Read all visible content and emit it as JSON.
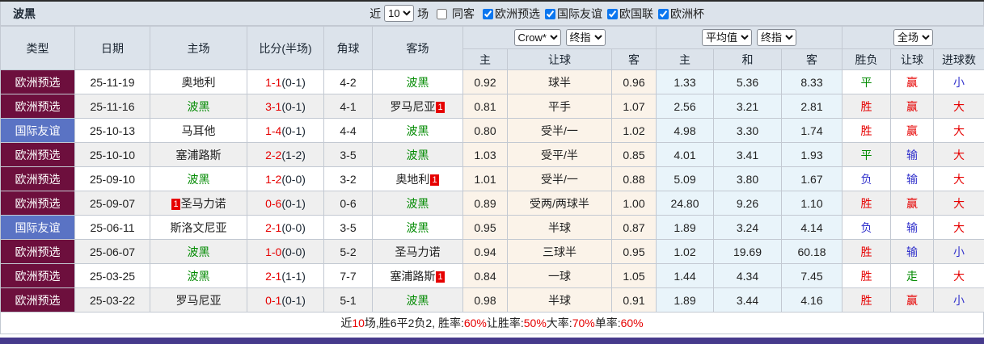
{
  "title": "波黑",
  "topbar": {
    "near_label": "近",
    "match_count": "10",
    "games_label": "场",
    "same_away": {
      "label": "同客",
      "checked": false
    },
    "filters": [
      {
        "label": "欧洲预选",
        "checked": true
      },
      {
        "label": "国际友谊",
        "checked": true
      },
      {
        "label": "欧国联",
        "checked": true
      },
      {
        "label": "欧洲杯",
        "checked": true
      }
    ]
  },
  "header": {
    "main": [
      "类型",
      "日期",
      "主场",
      "比分(半场)",
      "角球",
      "客场"
    ],
    "selects": {
      "bookmaker": "Crow*",
      "final1": "终指",
      "average": "平均值",
      "final2": "终指",
      "scope": "全场"
    },
    "sub": [
      "主",
      "让球",
      "客",
      "主",
      "和",
      "客",
      "胜负",
      "让球",
      "进球数"
    ]
  },
  "rows": [
    {
      "comp": "欧洲预选",
      "comp_style": "maroon",
      "date": "25-11-19",
      "home": {
        "name": "奥地利",
        "green": false,
        "badge": null
      },
      "score": {
        "full": "1-1",
        "half": "(0-1)"
      },
      "corner": "4-2",
      "away": {
        "name": "波黑",
        "green": true,
        "badge": null
      },
      "ah": {
        "home": "0.92",
        "line": "球半",
        "away": "0.96"
      },
      "eu": {
        "home": "1.33",
        "draw": "5.36",
        "away": "8.33"
      },
      "results": {
        "outcome": {
          "text": "平",
          "color": "green"
        },
        "handicap": {
          "text": "赢",
          "color": "red"
        },
        "goals": {
          "text": "小",
          "color": "blue"
        }
      }
    },
    {
      "comp": "欧洲预选",
      "comp_style": "maroon",
      "date": "25-11-16",
      "home": {
        "name": "波黑",
        "green": true,
        "badge": null
      },
      "score": {
        "full": "3-1",
        "half": "(0-1)"
      },
      "corner": "4-1",
      "away": {
        "name": "罗马尼亚",
        "green": false,
        "badge": {
          "text": "1",
          "pos": "after"
        }
      },
      "ah": {
        "home": "0.81",
        "line": "平手",
        "away": "1.07"
      },
      "eu": {
        "home": "2.56",
        "draw": "3.21",
        "away": "2.81"
      },
      "results": {
        "outcome": {
          "text": "胜",
          "color": "red"
        },
        "handicap": {
          "text": "赢",
          "color": "red"
        },
        "goals": {
          "text": "大",
          "color": "red"
        }
      }
    },
    {
      "comp": "国际友谊",
      "comp_style": "blue",
      "date": "25-10-13",
      "home": {
        "name": "马耳他",
        "green": false,
        "badge": null
      },
      "score": {
        "full": "1-4",
        "half": "(0-1)"
      },
      "corner": "4-4",
      "away": {
        "name": "波黑",
        "green": true,
        "badge": null
      },
      "ah": {
        "home": "0.80",
        "line": "受半/一",
        "away": "1.02"
      },
      "eu": {
        "home": "4.98",
        "draw": "3.30",
        "away": "1.74"
      },
      "results": {
        "outcome": {
          "text": "胜",
          "color": "red"
        },
        "handicap": {
          "text": "赢",
          "color": "red"
        },
        "goals": {
          "text": "大",
          "color": "red"
        }
      }
    },
    {
      "comp": "欧洲预选",
      "comp_style": "maroon",
      "date": "25-10-10",
      "home": {
        "name": "塞浦路斯",
        "green": false,
        "badge": null
      },
      "score": {
        "full": "2-2",
        "half": "(1-2)"
      },
      "corner": "3-5",
      "away": {
        "name": "波黑",
        "green": true,
        "badge": null
      },
      "ah": {
        "home": "1.03",
        "line": "受平/半",
        "away": "0.85"
      },
      "eu": {
        "home": "4.01",
        "draw": "3.41",
        "away": "1.93"
      },
      "results": {
        "outcome": {
          "text": "平",
          "color": "green"
        },
        "handicap": {
          "text": "输",
          "color": "blue"
        },
        "goals": {
          "text": "大",
          "color": "red"
        }
      }
    },
    {
      "comp": "欧洲预选",
      "comp_style": "maroon",
      "date": "25-09-10",
      "home": {
        "name": "波黑",
        "green": true,
        "badge": null
      },
      "score": {
        "full": "1-2",
        "half": "(0-0)"
      },
      "corner": "3-2",
      "away": {
        "name": "奥地利",
        "green": false,
        "badge": {
          "text": "1",
          "pos": "after"
        }
      },
      "ah": {
        "home": "1.01",
        "line": "受半/一",
        "away": "0.88"
      },
      "eu": {
        "home": "5.09",
        "draw": "3.80",
        "away": "1.67"
      },
      "results": {
        "outcome": {
          "text": "负",
          "color": "blue"
        },
        "handicap": {
          "text": "输",
          "color": "blue"
        },
        "goals": {
          "text": "大",
          "color": "red"
        }
      }
    },
    {
      "comp": "欧洲预选",
      "comp_style": "maroon",
      "date": "25-09-07",
      "home": {
        "name": "圣马力诺",
        "green": false,
        "badge": {
          "text": "1",
          "pos": "before"
        }
      },
      "score": {
        "full": "0-6",
        "half": "(0-1)"
      },
      "corner": "0-6",
      "away": {
        "name": "波黑",
        "green": true,
        "badge": null
      },
      "ah": {
        "home": "0.89",
        "line": "受两/两球半",
        "away": "1.00"
      },
      "eu": {
        "home": "24.80",
        "draw": "9.26",
        "away": "1.10"
      },
      "results": {
        "outcome": {
          "text": "胜",
          "color": "red"
        },
        "handicap": {
          "text": "赢",
          "color": "red"
        },
        "goals": {
          "text": "大",
          "color": "red"
        }
      }
    },
    {
      "comp": "国际友谊",
      "comp_style": "blue",
      "date": "25-06-11",
      "home": {
        "name": "斯洛文尼亚",
        "green": false,
        "badge": null
      },
      "score": {
        "full": "2-1",
        "half": "(0-0)"
      },
      "corner": "3-5",
      "away": {
        "name": "波黑",
        "green": true,
        "badge": null
      },
      "ah": {
        "home": "0.95",
        "line": "半球",
        "away": "0.87"
      },
      "eu": {
        "home": "1.89",
        "draw": "3.24",
        "away": "4.14"
      },
      "results": {
        "outcome": {
          "text": "负",
          "color": "blue"
        },
        "handicap": {
          "text": "输",
          "color": "blue"
        },
        "goals": {
          "text": "大",
          "color": "red"
        }
      }
    },
    {
      "comp": "欧洲预选",
      "comp_style": "maroon",
      "date": "25-06-07",
      "home": {
        "name": "波黑",
        "green": true,
        "badge": null
      },
      "score": {
        "full": "1-0",
        "half": "(0-0)"
      },
      "corner": "5-2",
      "away": {
        "name": "圣马力诺",
        "green": false,
        "badge": null
      },
      "ah": {
        "home": "0.94",
        "line": "三球半",
        "away": "0.95"
      },
      "eu": {
        "home": "1.02",
        "draw": "19.69",
        "away": "60.18"
      },
      "results": {
        "outcome": {
          "text": "胜",
          "color": "red"
        },
        "handicap": {
          "text": "输",
          "color": "blue"
        },
        "goals": {
          "text": "小",
          "color": "blue"
        }
      }
    },
    {
      "comp": "欧洲预选",
      "comp_style": "maroon",
      "date": "25-03-25",
      "home": {
        "name": "波黑",
        "green": true,
        "badge": null
      },
      "score": {
        "full": "2-1",
        "half": "(1-1)"
      },
      "corner": "7-7",
      "away": {
        "name": "塞浦路斯",
        "green": false,
        "badge": {
          "text": "1",
          "pos": "after"
        }
      },
      "ah": {
        "home": "0.84",
        "line": "一球",
        "away": "1.05"
      },
      "eu": {
        "home": "1.44",
        "draw": "4.34",
        "away": "7.45"
      },
      "results": {
        "outcome": {
          "text": "胜",
          "color": "red"
        },
        "handicap": {
          "text": "走",
          "color": "green"
        },
        "goals": {
          "text": "大",
          "color": "red"
        }
      }
    },
    {
      "comp": "欧洲预选",
      "comp_style": "maroon",
      "date": "25-03-22",
      "home": {
        "name": "罗马尼亚",
        "green": false,
        "badge": null
      },
      "score": {
        "full": "0-1",
        "half": "(0-1)"
      },
      "corner": "5-1",
      "away": {
        "name": "波黑",
        "green": true,
        "badge": null
      },
      "ah": {
        "home": "0.98",
        "line": "半球",
        "away": "0.91"
      },
      "eu": {
        "home": "1.89",
        "draw": "3.44",
        "away": "4.16"
      },
      "results": {
        "outcome": {
          "text": "胜",
          "color": "red"
        },
        "handicap": {
          "text": "赢",
          "color": "red"
        },
        "goals": {
          "text": "小",
          "color": "blue"
        }
      }
    }
  ],
  "footer": {
    "segments": [
      {
        "text": "近",
        "red": false
      },
      {
        "text": "10",
        "red": true
      },
      {
        "text": "场,胜6平2负2, 胜率:",
        "red": false
      },
      {
        "text": "60%",
        "red": true
      },
      {
        "text": " 让胜率:",
        "red": false
      },
      {
        "text": "50%",
        "red": true
      },
      {
        "text": " 大率:",
        "red": false
      },
      {
        "text": "70%",
        "red": true
      },
      {
        "text": " 单率:",
        "red": false
      },
      {
        "text": "60%",
        "red": true
      }
    ]
  },
  "colors": {
    "accent_maroon": "#6d0f3d",
    "accent_blue": "#5a73c4",
    "header_bg": "#dce3eb",
    "handicap_col_bg": "#fbf3e9",
    "odds_col_bg": "#e9f4fa",
    "alt_row_bg": "#efefef",
    "red": "#e60000",
    "green": "#008a00",
    "result_blue": "#3232cc",
    "bottom_bar": "#463a8c"
  }
}
